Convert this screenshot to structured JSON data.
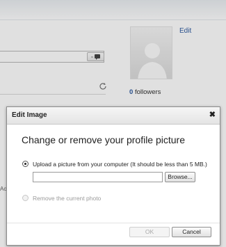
{
  "profile": {
    "edit_label": "Edit",
    "followers_count": "0",
    "followers_label": "followers",
    "partial_text": "Acc"
  },
  "dialog": {
    "title": "Edit Image",
    "close_glyph": "✖",
    "heading": "Change or remove your profile picture",
    "option_upload": "Upload a picture from your computer (It should be less than 5 MB.)",
    "option_upload_selected": true,
    "file_value": "",
    "browse_label": "Browse...",
    "option_remove": "Remove the current photo",
    "option_remove_enabled": false,
    "ok_label": "OK",
    "ok_enabled": false,
    "cancel_label": "Cancel"
  },
  "icons": {
    "send": "speech-bubble-icon",
    "refresh": "refresh-icon",
    "avatar": "default-avatar-icon"
  },
  "colors": {
    "link": "#2d5aa0",
    "dialog_border": "#8c8c8c"
  }
}
